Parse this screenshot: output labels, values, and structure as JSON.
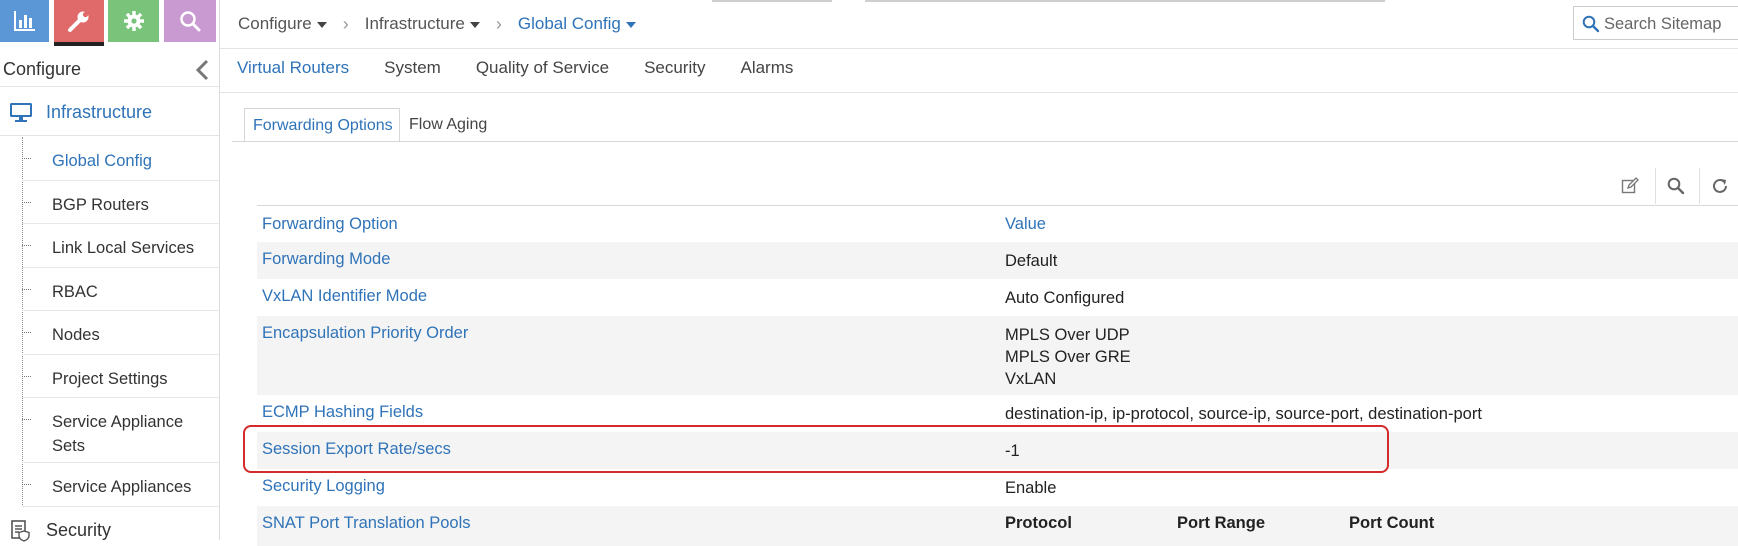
{
  "topnav": {
    "icons": [
      {
        "name": "monitor",
        "icon": "bar-chart-icon",
        "color": "#5b97d6"
      },
      {
        "name": "configure",
        "icon": "wrench-icon",
        "color": "#e06a6a",
        "active": true
      },
      {
        "name": "settings",
        "icon": "gear-icon",
        "color": "#79c37b"
      },
      {
        "name": "query",
        "icon": "search-icon",
        "color": "#c99ad2"
      }
    ]
  },
  "sidebar": {
    "title": "Configure",
    "section": "Infrastructure",
    "items": [
      {
        "label": "Global Config",
        "active": true
      },
      {
        "label": "BGP Routers"
      },
      {
        "label": "Link Local Services"
      },
      {
        "label": "RBAC"
      },
      {
        "label": "Nodes"
      },
      {
        "label": "Project Settings"
      },
      {
        "label": "Service Appliance Sets"
      },
      {
        "label": "Service Appliances"
      }
    ],
    "next_section": "Security"
  },
  "breadcrumb": [
    "Configure",
    "Infrastructure",
    "Global Config"
  ],
  "search": {
    "placeholder": "Search Sitemap"
  },
  "tabs": [
    "Virtual Routers",
    "System",
    "Quality of Service",
    "Security",
    "Alarms"
  ],
  "active_tab": "Virtual Routers",
  "subtabs": [
    "Forwarding Options",
    "Flow Aging"
  ],
  "active_subtab": "Forwarding Options",
  "grid": {
    "headers": {
      "key": "Forwarding Option",
      "value": "Value"
    },
    "rows": [
      {
        "key": "Forwarding Mode",
        "value": "Default"
      },
      {
        "key": "VxLAN Identifier Mode",
        "value": "Auto Configured"
      },
      {
        "key": "Encapsulation Priority Order",
        "values": [
          "MPLS Over UDP",
          "MPLS Over GRE",
          "VxLAN"
        ]
      },
      {
        "key": "ECMP Hashing Fields",
        "value": "destination-ip, ip-protocol, source-ip, source-port, destination-port"
      },
      {
        "key": "Session Export Rate/secs",
        "value": "-1",
        "highlighted": true
      },
      {
        "key": "Security Logging",
        "value": "Enable"
      },
      {
        "key": "SNAT Port Translation Pools",
        "subheaders": [
          "Protocol",
          "Port Range",
          "Port Count"
        ]
      }
    ]
  },
  "colors": {
    "accent": "#2f73b8",
    "highlight": "#d42a2a"
  }
}
